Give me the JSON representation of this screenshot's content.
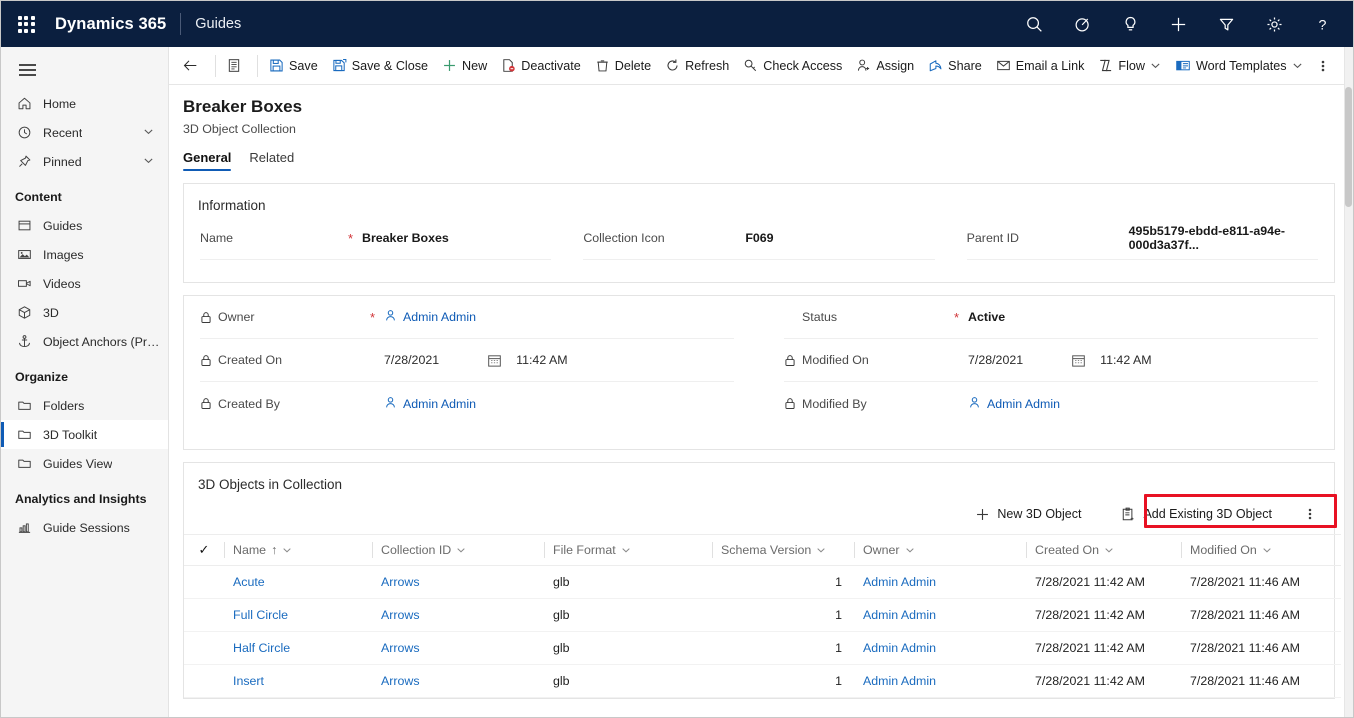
{
  "topnav": {
    "waffle_label": "app-launcher",
    "brand": "Dynamics 365",
    "app_name": "Guides",
    "icons": [
      {
        "name": "search-icon",
        "label": "Search"
      },
      {
        "name": "focus-target-icon",
        "label": "Focused view"
      },
      {
        "name": "lightbulb-icon",
        "label": "Insights"
      },
      {
        "name": "plus-icon",
        "label": "New"
      },
      {
        "name": "filter-icon",
        "label": "Filter"
      },
      {
        "name": "gear-icon",
        "label": "Settings"
      },
      {
        "name": "help-icon",
        "label": "Help"
      }
    ]
  },
  "sidebar": {
    "hamburger_label": "Expand navigation",
    "items": [
      {
        "label": "Home",
        "icon": "home-icon",
        "chevron": false,
        "selected": false
      },
      {
        "label": "Recent",
        "icon": "clock-icon",
        "chevron": true,
        "selected": false
      },
      {
        "label": "Pinned",
        "icon": "pin-icon",
        "chevron": true,
        "selected": false
      }
    ],
    "groups": [
      {
        "title": "Content",
        "items": [
          {
            "label": "Guides",
            "icon": "guides-icon",
            "selected": false
          },
          {
            "label": "Images",
            "icon": "image-icon",
            "selected": false
          },
          {
            "label": "Videos",
            "icon": "video-icon",
            "selected": false
          },
          {
            "label": "3D",
            "icon": "cube-icon",
            "selected": false
          },
          {
            "label": "Object Anchors (Prev...",
            "icon": "anchor-icon",
            "selected": false
          }
        ]
      },
      {
        "title": "Organize",
        "items": [
          {
            "label": "Folders",
            "icon": "folder-icon",
            "selected": false
          },
          {
            "label": "3D Toolkit",
            "icon": "folder-icon",
            "selected": true
          },
          {
            "label": "Guides View",
            "icon": "folder-icon",
            "selected": false
          }
        ]
      },
      {
        "title": "Analytics and Insights",
        "items": [
          {
            "label": "Guide Sessions",
            "icon": "chart-icon",
            "selected": false
          }
        ]
      }
    ]
  },
  "commandbar": {
    "back_label": "Back",
    "form_selector_label": "Form selector",
    "commands": [
      {
        "label": "Save",
        "icon": "save-icon"
      },
      {
        "label": "Save & Close",
        "icon": "save-close-icon"
      },
      {
        "label": "New",
        "icon": "plus-icon"
      },
      {
        "label": "Deactivate",
        "icon": "deactivate-icon"
      },
      {
        "label": "Delete",
        "icon": "trash-icon"
      },
      {
        "label": "Refresh",
        "icon": "refresh-icon"
      },
      {
        "label": "Check Access",
        "icon": "key-icon"
      },
      {
        "label": "Assign",
        "icon": "assign-user-icon"
      },
      {
        "label": "Share",
        "icon": "share-icon"
      },
      {
        "label": "Email a Link",
        "icon": "email-icon"
      },
      {
        "label": "Flow",
        "icon": "flow-icon",
        "chevron": true
      },
      {
        "label": "Word Templates",
        "icon": "word-template-icon",
        "chevron": true
      }
    ],
    "overflow_label": "More commands"
  },
  "record": {
    "title": "Breaker Boxes",
    "subtitle": "3D Object Collection",
    "tabs": [
      {
        "label": "General",
        "active": true
      },
      {
        "label": "Related",
        "active": false
      }
    ]
  },
  "information": {
    "section_title": "Information",
    "fields": [
      {
        "label": "Name",
        "value": "Breaker Boxes",
        "required": true
      },
      {
        "label": "Collection Icon",
        "value": "F069",
        "required": false
      },
      {
        "label": "Parent ID",
        "value": "495b5179-ebdd-e811-a94e-000d3a37f...",
        "required": false
      }
    ]
  },
  "audit": {
    "left": [
      {
        "label": "Owner",
        "value": "Admin Admin",
        "required": true,
        "locked": true,
        "type": "person"
      },
      {
        "label": "Created On",
        "date": "7/28/2021",
        "time": "11:42 AM",
        "required": false,
        "locked": true,
        "type": "datetime"
      },
      {
        "label": "Created By",
        "value": "Admin Admin",
        "required": false,
        "locked": true,
        "type": "person"
      }
    ],
    "right": [
      {
        "label": "Status",
        "value": "Active",
        "required": true,
        "locked": false,
        "type": "text"
      },
      {
        "label": "Modified On",
        "date": "7/28/2021",
        "time": "11:42 AM",
        "required": false,
        "locked": true,
        "type": "datetime"
      },
      {
        "label": "Modified By",
        "value": "Admin Admin",
        "required": false,
        "locked": true,
        "type": "person"
      }
    ]
  },
  "subgrid": {
    "title": "3D Objects in Collection",
    "actions": [
      {
        "label": "New 3D Object",
        "icon": "plus-icon",
        "highlighted": false
      },
      {
        "label": "Add Existing 3D Object",
        "icon": "add-existing-icon",
        "highlighted": true
      }
    ],
    "overflow_label": "More commands",
    "highlight_color": "#e81123",
    "columns": [
      {
        "label": "Name",
        "sorted": true,
        "sort_arrow": "↑"
      },
      {
        "label": "Collection ID"
      },
      {
        "label": "File Format"
      },
      {
        "label": "Schema Version"
      },
      {
        "label": "Owner"
      },
      {
        "label": "Created On"
      },
      {
        "label": "Modified On"
      }
    ],
    "rows": [
      {
        "name": "Acute",
        "collection_id": "Arrows",
        "file_format": "glb",
        "schema_version": "1",
        "owner": "Admin Admin",
        "created_on": "7/28/2021 11:42 AM",
        "modified_on": "7/28/2021 11:46 AM"
      },
      {
        "name": "Full Circle",
        "collection_id": "Arrows",
        "file_format": "glb",
        "schema_version": "1",
        "owner": "Admin Admin",
        "created_on": "7/28/2021 11:42 AM",
        "modified_on": "7/28/2021 11:46 AM"
      },
      {
        "name": "Half Circle",
        "collection_id": "Arrows",
        "file_format": "glb",
        "schema_version": "1",
        "owner": "Admin Admin",
        "created_on": "7/28/2021 11:42 AM",
        "modified_on": "7/28/2021 11:46 AM"
      },
      {
        "name": "Insert",
        "collection_id": "Arrows",
        "file_format": "glb",
        "schema_version": "1",
        "owner": "Admin Admin",
        "created_on": "7/28/2021 11:42 AM",
        "modified_on": "7/28/2021 11:46 AM"
      }
    ]
  },
  "theme": {
    "nav_bg": "#0b1f3f",
    "accent": "#0f5bb5",
    "link": "#1a6bbf",
    "required": "#d13438"
  }
}
